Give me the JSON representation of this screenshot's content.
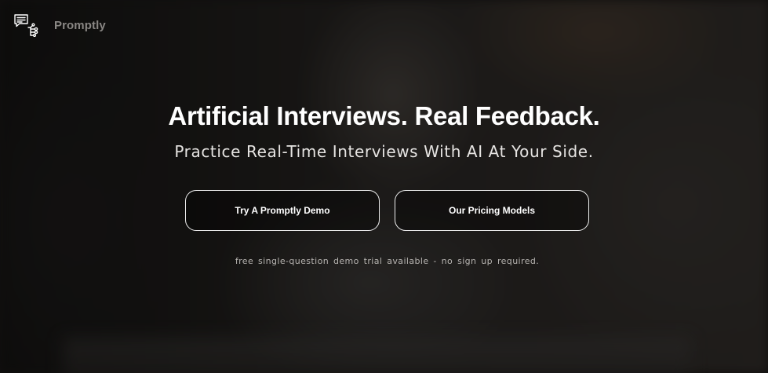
{
  "brand": {
    "name": "Promptly",
    "logo_icon": "chat-network-icon"
  },
  "hero": {
    "headline": "Artificial Interviews. Real Feedback.",
    "subheadline": "Practice Real-Time Interviews With AI At Your Side.",
    "demo_button_label": "Try A Promptly Demo",
    "pricing_button_label": "Our Pricing Models",
    "note": "free single-question demo trial available - no sign up required."
  },
  "colors": {
    "overlay": "#000000",
    "text_primary": "#ffffff",
    "brand_text": "#8a8784",
    "button_border": "#eeeeee"
  }
}
